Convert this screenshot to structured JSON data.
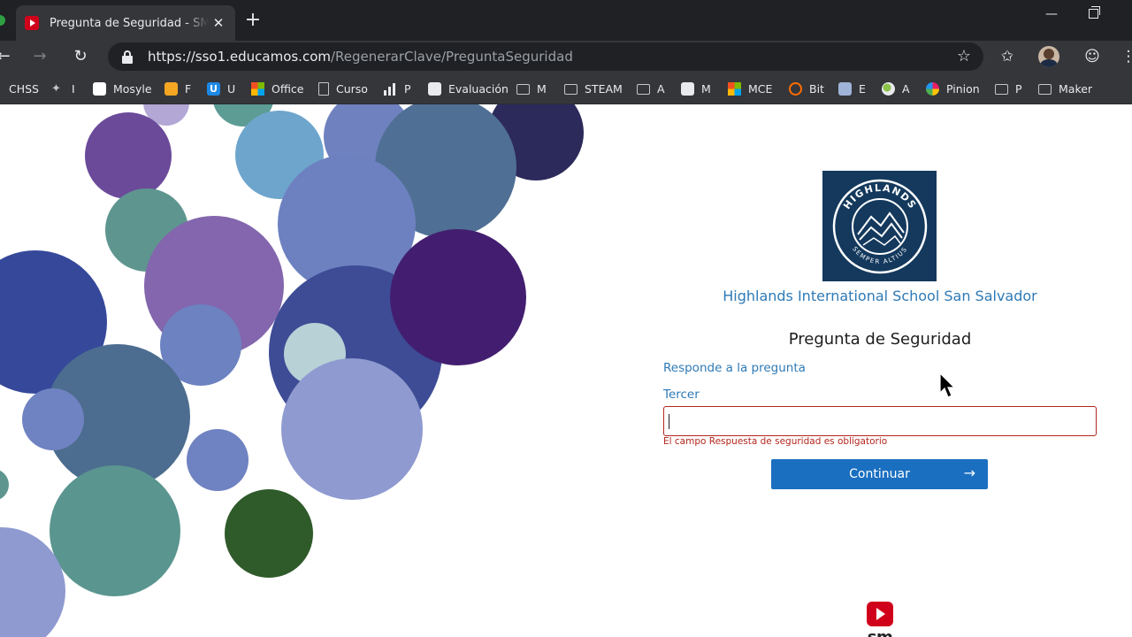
{
  "browser": {
    "tab_title": "Pregunta de Seguridad - SM Educamos",
    "tab_close": "✕",
    "new_tab": "+",
    "url_host": "https://sso1.educamos.com",
    "url_path": "/RegenerarClave/PreguntaSeguridad"
  },
  "bookmarks": [
    {
      "label": "CHSS"
    },
    {
      "label": "I"
    },
    {
      "label": "Mosyle"
    },
    {
      "label": "F"
    },
    {
      "label": "U"
    },
    {
      "label": "Office"
    },
    {
      "label": "Curso"
    },
    {
      "label": "P"
    },
    {
      "label": "Evaluación"
    },
    {
      "label": "M"
    },
    {
      "label": "STEAM"
    },
    {
      "label": "A"
    },
    {
      "label": "M"
    },
    {
      "label": "MCE"
    },
    {
      "label": "Bit"
    },
    {
      "label": "E"
    },
    {
      "label": "A"
    },
    {
      "label": "Pinion"
    },
    {
      "label": "P"
    },
    {
      "label": "Maker"
    }
  ],
  "school": {
    "name": "Highlands International School San Salvador",
    "logo_text_top": "HIGHLANDS",
    "logo_text_bottom": "SEMPER ALTIUS"
  },
  "form": {
    "title": "Pregunta de Seguridad",
    "prompt": "Responde a la pregunta",
    "field_label": "Tercer",
    "answer_value": "",
    "error": "El campo Respuesta de seguridad es obligatorio",
    "continue_label": "Continuar"
  },
  "footer": {
    "brand": "sm educamos"
  },
  "colors": {
    "accent": "#1a6fc0",
    "link": "#2e7ab6",
    "error": "#b3261e",
    "logo_bg": "#14395d"
  }
}
